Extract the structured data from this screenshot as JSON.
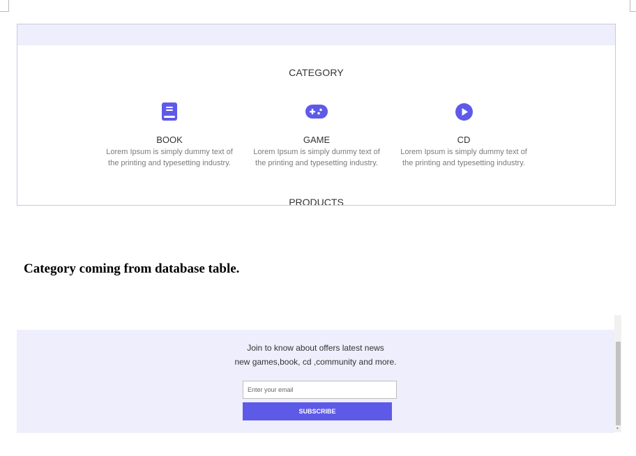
{
  "section": {
    "category_title": "CATEGORY",
    "products_title": "PRODUCTS"
  },
  "categories": [
    {
      "name": "BOOK",
      "icon": "book-icon",
      "desc_line1": "Lorem Ipsum is simply dummy text of",
      "desc_line2": "the printing and typesetting industry."
    },
    {
      "name": "GAME",
      "icon": "gamepad-icon",
      "desc_line1": "Lorem Ipsum is simply dummy text of",
      "desc_line2": "the printing and typesetting industry."
    },
    {
      "name": "CD",
      "icon": "play-circle-icon",
      "desc_line1": "Lorem Ipsum is simply dummy text of",
      "desc_line2": "the printing and typesetting industry."
    }
  ],
  "note": "Category coming from database table.",
  "newsletter": {
    "line1": "Join to know about offers latest news",
    "line2": "new games,book, cd ,community and more.",
    "email_placeholder": "Enter your email",
    "subscribe_label": "SUBSCRIBE"
  },
  "colors": {
    "accent": "#5e5ae8",
    "panel_bg": "#efeefc"
  }
}
